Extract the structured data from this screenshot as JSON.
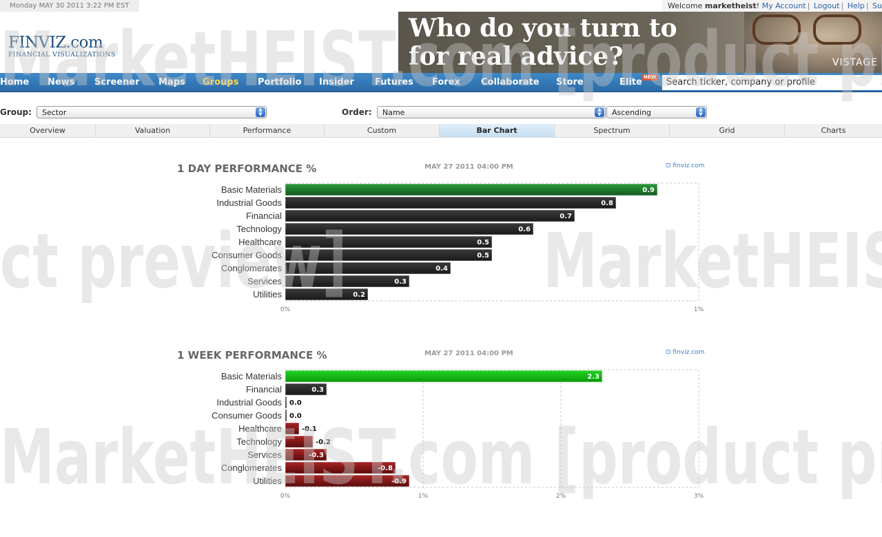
{
  "topbar": {
    "date": "Monday MAY 30 2011 3:22 PM EST",
    "welcome_prefix": "Welcome ",
    "username": "marketheist",
    "welcome_suffix": "! ",
    "links": [
      "My Account",
      "Logout",
      "Help",
      "Su"
    ]
  },
  "logo": {
    "main": "FINVIZ.com",
    "sub": "FINANCIAL VISUALIZATIONS"
  },
  "ad": {
    "line1": "Who do you turn to",
    "line2": "for real advice?",
    "brand": "VISTAGE"
  },
  "nav": {
    "items": [
      "Home",
      "News",
      "Screener",
      "Maps",
      "Groups",
      "Portfolio",
      "Insider",
      "Futures",
      "Forex",
      "Collaborate",
      "Store",
      "Elite"
    ],
    "new_badge": "NEW",
    "search_placeholder": "Search ticker, company or profile"
  },
  "group_bar": {
    "group_label": "Group:",
    "group_value": "Sector",
    "order_label": "Order:",
    "order_value": "Name",
    "direction_value": "Ascending"
  },
  "tabs": [
    "Overview",
    "Valuation",
    "Performance",
    "Custom",
    "Bar Chart",
    "Spectrum",
    "Grid",
    "Charts"
  ],
  "active_tab": "Bar Chart",
  "watermark": {
    "line1": "MarketHEIST.com [product preview]",
    "line2": "ct preview]",
    "line3": "MarketHEIST.com [product preview]",
    "line4": "MarketHEIST."
  },
  "colors": {
    "positive_bright": "#14b814",
    "positive": "#1c7a28",
    "negative": "#8a1616",
    "neutral": "#2a2a2a",
    "nav": "#2f76b5"
  },
  "charts": [
    {
      "title": "1 DAY PERFORMANCE %",
      "date": "MAY 27 2011 04:00 PM",
      "source": "finviz.com"
    },
    {
      "title": "1 WEEK PERFORMANCE %",
      "date": "MAY 27 2011 04:00 PM",
      "source": "finviz.com"
    }
  ],
  "chart_data": [
    {
      "type": "bar",
      "title": "1 DAY PERFORMANCE %",
      "orientation": "horizontal",
      "categories": [
        "Basic Materials",
        "Industrial Goods",
        "Financial",
        "Technology",
        "Healthcare",
        "Consumer Goods",
        "Conglomerates",
        "Services",
        "Utilities"
      ],
      "values": [
        0.9,
        0.8,
        0.7,
        0.6,
        0.5,
        0.5,
        0.4,
        0.3,
        0.2
      ],
      "xlim": [
        0,
        1
      ],
      "tick_labels": [
        "0%",
        "1%"
      ],
      "ticks": [
        0,
        1
      ]
    },
    {
      "type": "bar",
      "title": "1 WEEK PERFORMANCE %",
      "orientation": "horizontal",
      "categories": [
        "Basic Materials",
        "Financial",
        "Industrial Goods",
        "Consumer Goods",
        "Healthcare",
        "Technology",
        "Services",
        "Conglomerates",
        "Utilities"
      ],
      "values": [
        2.3,
        0.3,
        0.0,
        0.0,
        -0.1,
        -0.2,
        -0.3,
        -0.8,
        -0.9
      ],
      "labels": [
        "2.3",
        "0.3",
        "0.0",
        "0.0",
        "-0.1",
        "-0.2",
        "-0.3",
        "-0.8",
        "-0.9"
      ],
      "xlim": [
        0,
        3
      ],
      "tick_labels": [
        "0%",
        "1%",
        "2%",
        "3%"
      ],
      "ticks": [
        0,
        1,
        2,
        3
      ]
    }
  ]
}
